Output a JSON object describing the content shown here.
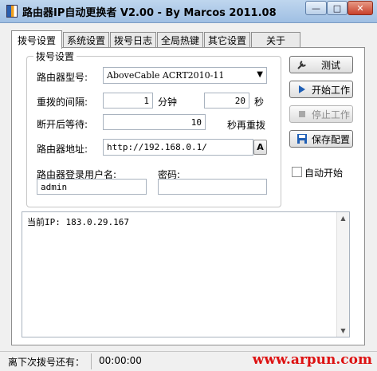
{
  "window": {
    "title": "路由器IP自动更换者 V2.00 - By Marcos 2011.08",
    "min_glyph": "—",
    "max_glyph": "□",
    "close_glyph": "✕"
  },
  "tabs": [
    {
      "label": "拨号设置",
      "active": true
    },
    {
      "label": "系统设置",
      "active": false
    },
    {
      "label": "拨号日志",
      "active": false
    },
    {
      "label": "全局热键",
      "active": false
    },
    {
      "label": "其它设置",
      "active": false
    },
    {
      "label": "关于",
      "active": false
    }
  ],
  "dial": {
    "group_title": "拨号设置",
    "router_model_label": "路由器型号:",
    "router_model_value": "AboveCable ACRT2010-11",
    "redial_interval_label": "重拨的间隔:",
    "interval_value": "1",
    "minutes_label": "分钟",
    "seconds_value": "20",
    "seconds_label": "秒",
    "wait_label": "断开后等待:",
    "wait_value": "10",
    "wait_suffix": "秒再重拨",
    "address_label": "路由器地址:",
    "address_value": "http://192.168.0.1/",
    "address_btn": "A",
    "username_label": "路由器登录用户名:",
    "username_value": "admin",
    "password_label": "密码:",
    "password_value": ""
  },
  "actions": {
    "test": "测试",
    "start": "开始工作",
    "stop": "停止工作",
    "save": "保存配置",
    "auto_start": "自动开始"
  },
  "log": {
    "text": "当前IP: 183.0.29.167"
  },
  "status": {
    "label": "离下次拨号还有：",
    "time": "00:00:00"
  },
  "watermark": "www.arpun.com",
  "colors": {
    "accent_blue": "#1f5fb5",
    "watermark_red": "#dd1111"
  }
}
